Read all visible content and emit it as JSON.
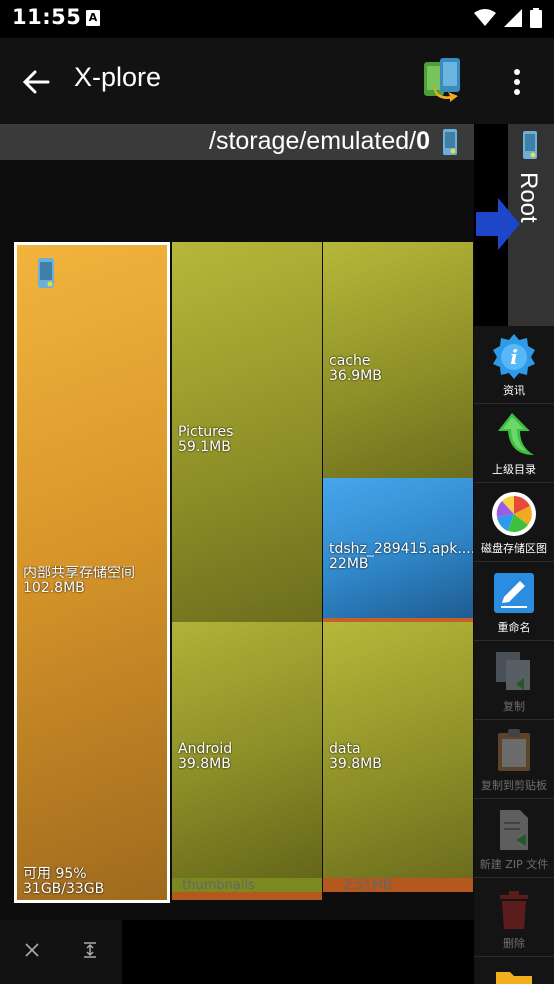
{
  "status_bar": {
    "time": "11:55",
    "notification_letter": "A"
  },
  "app_bar": {
    "title": "X-plore"
  },
  "path": {
    "prefix": "/storage/emulated/",
    "last": "0"
  },
  "root_pane": {
    "label": "Root"
  },
  "treemap": {
    "main": {
      "name": "内部共享存储空间",
      "size": "102.8MB",
      "free_label": "可用 95%",
      "free_size": "31GB/33GB"
    },
    "pictures": {
      "name": "Pictures",
      "size": "59.1MB"
    },
    "android": {
      "name": "Android",
      "size": "39.8MB"
    },
    "thumbnail": {
      "name": ".thumbnails"
    },
    "cache": {
      "name": "cache",
      "size": "36.9MB"
    },
    "apk": {
      "name": "tdshz_289415.apk....",
      "size": "22MB"
    },
    "data": {
      "name": "data",
      "size": "39.8MB"
    },
    "small": {
      "size": "2.51MB"
    }
  },
  "toolbar": {
    "items": [
      {
        "label": "资讯"
      },
      {
        "label": "上级目录"
      },
      {
        "label": "磁盘存储区图"
      },
      {
        "label": "重命名"
      },
      {
        "label": "复制"
      },
      {
        "label": "复制到剪贴板"
      },
      {
        "label": "新建 ZIP 文件"
      },
      {
        "label": "删除"
      }
    ]
  },
  "colors": {
    "accent_green": "#3fbf3f",
    "info_blue": "#2f9be8",
    "delete_red": "#c62828"
  }
}
